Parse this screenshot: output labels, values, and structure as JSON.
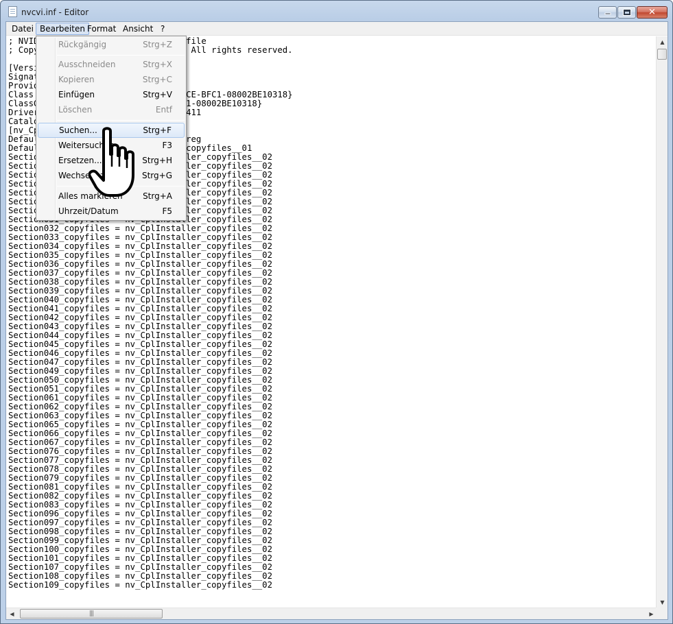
{
  "window": {
    "title": "nvcvi.inf - Editor",
    "buttons": {
      "minimize": "minimize-icon",
      "maximize": "maximize-icon",
      "close": "close-icon"
    }
  },
  "menubar": [
    {
      "label": "Datei"
    },
    {
      "label": "Bearbeiten",
      "active": true
    },
    {
      "label": "Format"
    },
    {
      "label": "Ansicht"
    },
    {
      "label": "?"
    }
  ],
  "editor": {
    "lines": [
      "; NVIDIA Control Panel Display INF file",
      "; Copyright (c) NVIDIA Corporation. All rights reserved.",
      "",
      "[Version]",
      "Signature = \"$WINDOWS NT$\"",
      "Provider = %NVIDIA%",
      "Class = Display ; {4D36E968-E325-11CE-BFC1-08002BE10318}",
      "ClassGUID = {4D36E968-E325-11CE-BFC1-08002BE10318}",
      "DriverVer = 09/15/2008, 7.15.11.8.4411",
      "CatalogFile = nvcvi.cat",
      "[nv_CplInstaller]",
      "DefaultAddReg = nv_CplInstaller_addreg",
      "DefaultCopyFiles = nv_CplInstaller_copyfiles__01",
      "Section001_copyfiles = nv_CplInstaller_copyfiles__02",
      "Section002_copyfiles = nv_CplInstaller_copyfiles__02",
      "Section003_copyfiles = nv_CplInstaller_copyfiles__02",
      "Section004_copyfiles = nv_CplInstaller_copyfiles__02",
      "Section005_copyfiles = nv_CplInstaller_copyfiles__02",
      "Section006_copyfiles = nv_CplInstaller_copyfiles__02",
      "Section007_copyfiles = nv_CplInstaller_copyfiles__02",
      "Section031_copyfiles = nv_CplInstaller_copyfiles__02",
      "Section032_copyfiles = nv_CplInstaller_copyfiles__02",
      "Section033_copyfiles = nv_CplInstaller_copyfiles__02",
      "Section034_copyfiles = nv_CplInstaller_copyfiles__02",
      "Section035_copyfiles = nv_CplInstaller_copyfiles__02",
      "Section036_copyfiles = nv_CplInstaller_copyfiles__02",
      "Section037_copyfiles = nv_CplInstaller_copyfiles__02",
      "Section038_copyfiles = nv_CplInstaller_copyfiles__02",
      "Section039_copyfiles = nv_CplInstaller_copyfiles__02",
      "Section040_copyfiles = nv_CplInstaller_copyfiles__02",
      "Section041_copyfiles = nv_CplInstaller_copyfiles__02",
      "Section042_copyfiles = nv_CplInstaller_copyfiles__02",
      "Section043_copyfiles = nv_CplInstaller_copyfiles__02",
      "Section044_copyfiles = nv_CplInstaller_copyfiles__02",
      "Section045_copyfiles = nv_CplInstaller_copyfiles__02",
      "Section046_copyfiles = nv_CplInstaller_copyfiles__02",
      "Section047_copyfiles = nv_CplInstaller_copyfiles__02",
      "Section049_copyfiles = nv_CplInstaller_copyfiles__02",
      "Section050_copyfiles = nv_CplInstaller_copyfiles__02",
      "Section051_copyfiles = nv_CplInstaller_copyfiles__02",
      "Section061_copyfiles = nv_CplInstaller_copyfiles__02",
      "Section062_copyfiles = nv_CplInstaller_copyfiles__02",
      "Section063_copyfiles = nv_CplInstaller_copyfiles__02",
      "Section065_copyfiles = nv_CplInstaller_copyfiles__02",
      "Section066_copyfiles = nv_CplInstaller_copyfiles__02",
      "Section067_copyfiles = nv_CplInstaller_copyfiles__02",
      "Section076_copyfiles = nv_CplInstaller_copyfiles__02",
      "Section077_copyfiles = nv_CplInstaller_copyfiles__02",
      "Section078_copyfiles = nv_CplInstaller_copyfiles__02",
      "Section079_copyfiles = nv_CplInstaller_copyfiles__02",
      "Section081_copyfiles = nv_CplInstaller_copyfiles__02",
      "Section082_copyfiles = nv_CplInstaller_copyfiles__02",
      "Section083_copyfiles = nv_CplInstaller_copyfiles__02",
      "Section096_copyfiles = nv_CplInstaller_copyfiles__02",
      "Section097_copyfiles = nv_CplInstaller_copyfiles__02",
      "Section098_copyfiles = nv_CplInstaller_copyfiles__02",
      "Section099_copyfiles = nv_CplInstaller_copyfiles__02",
      "Section100_copyfiles = nv_CplInstaller_copyfiles__02",
      "Section101_copyfiles = nv_CplInstaller_copyfiles__02",
      "Section107_copyfiles = nv_CplInstaller_copyfiles__02",
      "Section108_copyfiles = nv_CplInstaller_copyfiles__02",
      "Section109_copyfiles = nv_CplInstaller_copyfiles__02"
    ]
  },
  "edit_menu": {
    "items": [
      {
        "label": "Rückgängig",
        "shortcut": "Strg+Z",
        "enabled": false
      },
      {
        "separator": true
      },
      {
        "label": "Ausschneiden",
        "shortcut": "Strg+X",
        "enabled": false
      },
      {
        "label": "Kopieren",
        "shortcut": "Strg+C",
        "enabled": false
      },
      {
        "label": "Einfügen",
        "shortcut": "Strg+V",
        "enabled": true
      },
      {
        "label": "Löschen",
        "shortcut": "Entf",
        "enabled": false
      },
      {
        "separator": true
      },
      {
        "label": "Suchen...",
        "shortcut": "Strg+F",
        "enabled": true,
        "highlighted": true
      },
      {
        "label": "Weitersuchen",
        "shortcut": "F3",
        "enabled": true
      },
      {
        "label": "Ersetzen...",
        "shortcut": "Strg+H",
        "enabled": true
      },
      {
        "label": "Wechseln zu...",
        "shortcut": "Strg+G",
        "enabled": true
      },
      {
        "separator": true
      },
      {
        "label": "Alles markieren",
        "shortcut": "Strg+A",
        "enabled": true
      },
      {
        "label": "Uhrzeit/Datum",
        "shortcut": "F5",
        "enabled": true
      }
    ]
  },
  "cursor": {
    "icon": "hand-pointer-icon"
  },
  "colors": {
    "titlebar": "#bcd0e8",
    "menu_highlight": "#d9e4f3",
    "close_button": "#c0472f",
    "disabled_text": "#8a8a8a"
  }
}
